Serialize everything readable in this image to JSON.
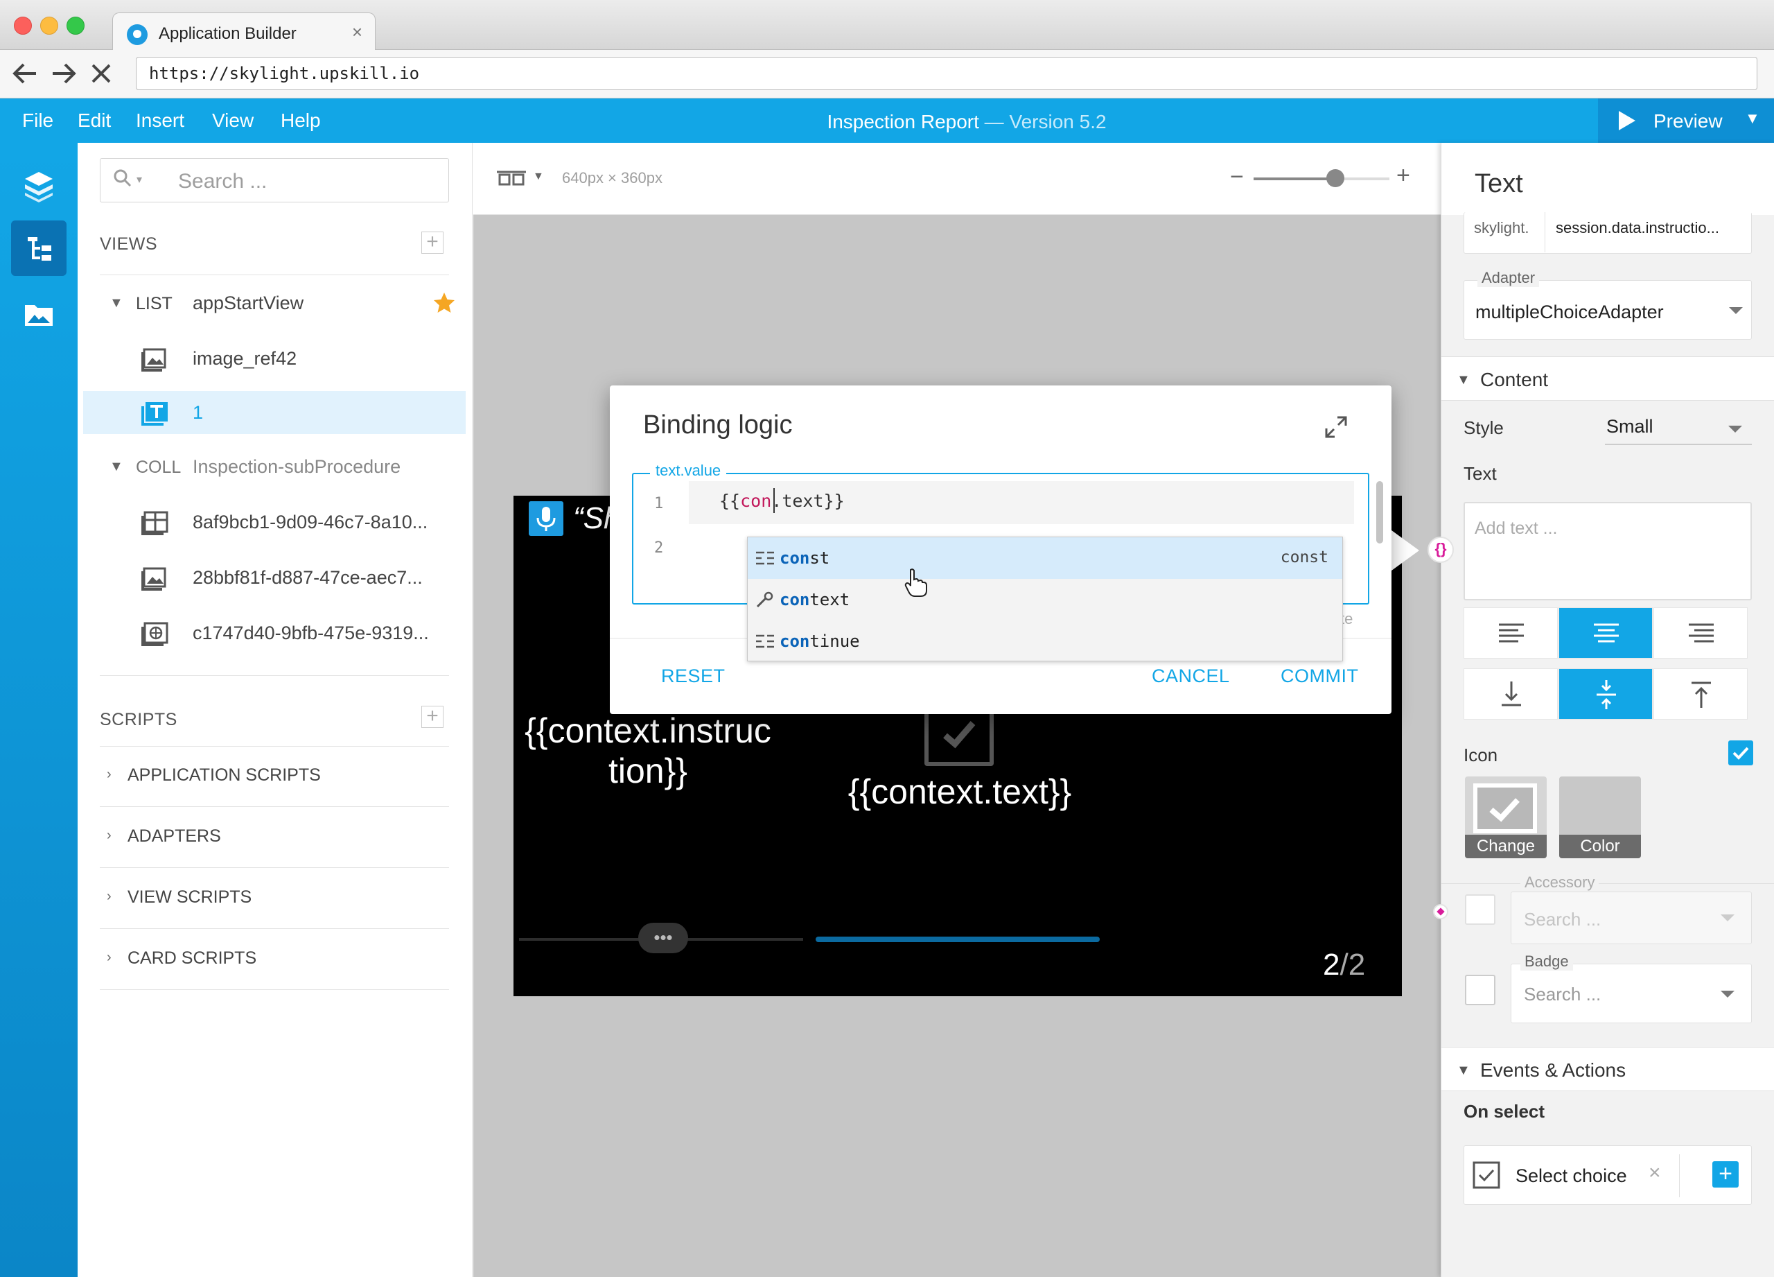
{
  "browser": {
    "tab_title": "Application Builder",
    "tab_close": "×",
    "url": "https://skylight.upskill.io",
    "back_icon": "arrow-left-icon",
    "forward_icon": "arrow-right-icon",
    "stop_icon": "close-icon"
  },
  "menubar": {
    "items": [
      "File",
      "Edit",
      "Insert",
      "View",
      "Help"
    ],
    "doc_title": "Inspection Report",
    "doc_version": " — Version 5.2",
    "preview_label": "Preview"
  },
  "tree": {
    "search_placeholder": "Search ...",
    "views_label": "VIEWS",
    "scripts_label": "SCRIPTS",
    "list_tag": "LIST",
    "list_name": "appStartView",
    "list_children": [
      "image_ref42",
      "1"
    ],
    "coll_tag": "COLL",
    "coll_name": "Inspection-subProcedure",
    "coll_children": [
      "8af9bcb1-9d09-46c7-8a10...",
      "28bbf81f-d887-47ce-aec7...",
      "c1747d40-9bfb-475e-9319..."
    ],
    "script_groups": [
      "APPLICATION SCRIPTS",
      "ADAPTERS",
      "VIEW SCRIPTS",
      "CARD SCRIPTS"
    ]
  },
  "canvas": {
    "dims": "640px × 360px",
    "zoom_level": 0.6,
    "device_header": "“Sh",
    "card_left_text": "{{context.instruc tion}}",
    "card_right_text": "{{context.text}}",
    "dots": "•••",
    "pager_current": "2",
    "pager_total": "/2"
  },
  "modal": {
    "title": "Binding logic",
    "field_label": "text.value",
    "line_numbers": [
      "1",
      "2"
    ],
    "code_prefix": "{{",
    "code_typed": "con",
    "code_suffix": ".text}}",
    "hint_fragment": "te",
    "reset": "RESET",
    "cancel": "CANCEL",
    "commit": "COMMIT"
  },
  "autocomplete": {
    "items": [
      {
        "match": "con",
        "rest": "st",
        "detail": "const",
        "icon": "keyword-icon"
      },
      {
        "match": "con",
        "rest": "text",
        "detail": "",
        "icon": "wrench-icon"
      },
      {
        "match": "con",
        "rest": "tinue",
        "detail": "",
        "icon": "keyword-icon"
      }
    ]
  },
  "props": {
    "header": "Text",
    "skylight_prefix": "skylight.",
    "skylight_value": "session.data.instructio...",
    "adapter_label": "Adapter",
    "adapter_value": "multipleChoiceAdapter",
    "content_section": "Content",
    "style_label": "Style",
    "style_value": "Small",
    "text_label": "Text",
    "text_placeholder": "Add text ...",
    "icon_label": "Icon",
    "icon_change": "Change",
    "icon_color": "Color",
    "accessory_label": "Accessory",
    "accessory_placeholder": "Search ...",
    "badge_label": "Badge",
    "badge_placeholder": "Search ...",
    "events_section": "Events & Actions",
    "on_select_label": "On select",
    "action_label": "Select choice",
    "action_remove": "×",
    "add_action": "+"
  },
  "colors": {
    "accent": "#12a6e6",
    "accent_dark": "#0e8fd4",
    "binding_magenta": "#d81b9a"
  }
}
